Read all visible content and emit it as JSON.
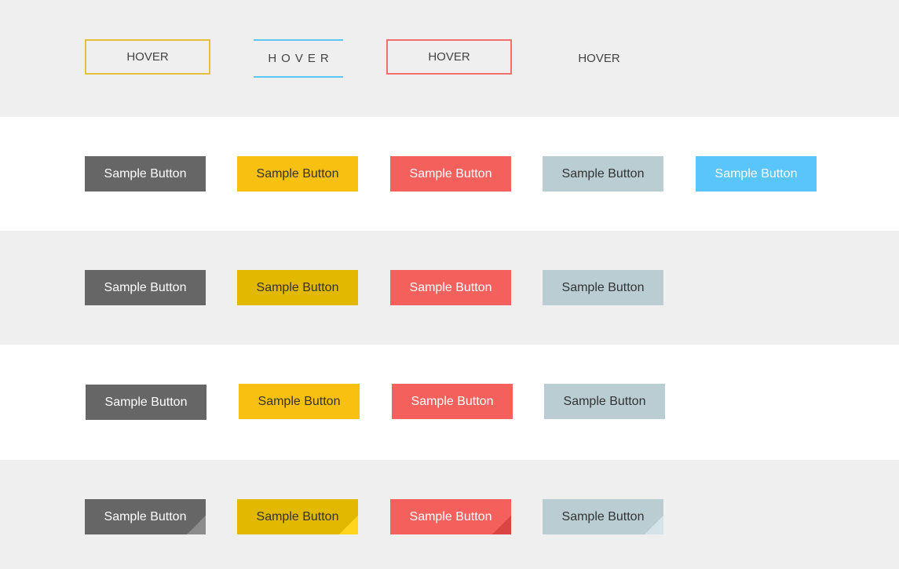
{
  "hover_row": {
    "buttons": [
      "HOVER",
      "HOVER",
      "HOVER",
      "HOVER"
    ]
  },
  "flat_row": {
    "buttons": [
      "Sample Button",
      "Sample Button",
      "Sample Button",
      "Sample Button",
      "Sample Button"
    ]
  },
  "solid_row": {
    "buttons": [
      "Sample Button",
      "Sample Button",
      "Sample Button",
      "Sample Button"
    ]
  },
  "shifted_row": {
    "buttons": [
      "Sample Button",
      "Sample Button",
      "Sample Button",
      "Sample Button"
    ]
  },
  "folded_row": {
    "buttons": [
      "Sample Button",
      "Sample Button",
      "Sample Button",
      "Sample Button"
    ]
  },
  "colors": {
    "dark": "#666666",
    "yellow": "#f8c011",
    "dark_yellow": "#e2b800",
    "red": "#f4615c",
    "blue_gray": "#b9cdd3",
    "sky_blue": "#5ac5fa",
    "outline_yellow": "#e8bf3a",
    "outline_blue": "#5bc6f2",
    "outline_red": "#f0706c"
  }
}
